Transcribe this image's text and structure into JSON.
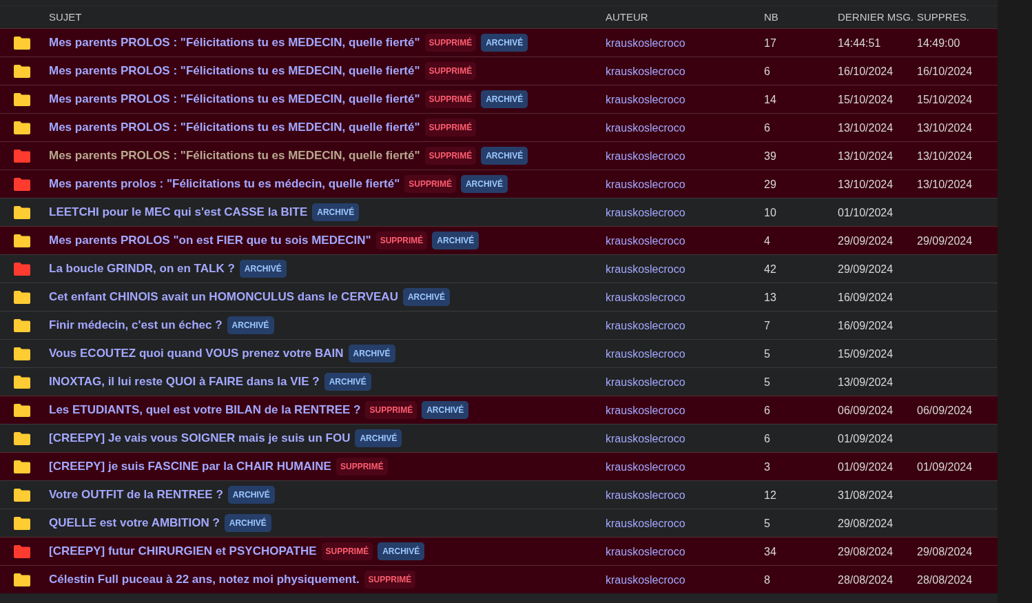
{
  "columns": [
    "SUJET",
    "AUTEUR",
    "NB",
    "DERNIER MSG.",
    "SUPPRES."
  ],
  "rows": [
    {
      "title": "Mes parents PROLOS : \"Félicitations tu es MEDECIN, quelle fierté\"",
      "color": "#ffcc33",
      "visited": false,
      "deleted_badge": "SUPPRIMÉ",
      "archived_badge": "ARCHIVÉ",
      "author": "krauskoslecroco",
      "count": "17",
      "last_message": "14:44:51",
      "deleted_at": "14:49:00"
    },
    {
      "title": "Mes parents PROLOS : \"Félicitations tu es MEDECIN, quelle fierté\"",
      "color": "#ffcc33",
      "visited": false,
      "deleted_badge": "SUPPRIMÉ",
      "author": "krauskoslecroco",
      "count": "6",
      "last_message": "16/10/2024",
      "deleted_at": "16/10/2024"
    },
    {
      "title": "Mes parents PROLOS : \"Félicitations tu es MEDECIN, quelle fierté\"",
      "color": "#ffcc33",
      "visited": false,
      "deleted_badge": "SUPPRIMÉ",
      "archived_badge": "ARCHIVÉ",
      "author": "krauskoslecroco",
      "count": "14",
      "last_message": "15/10/2024",
      "deleted_at": "15/10/2024"
    },
    {
      "title": "Mes parents PROLOS : \"Félicitations tu es MEDECIN, quelle fierté\"",
      "color": "#ffcc33",
      "visited": false,
      "deleted_badge": "SUPPRIMÉ",
      "author": "krauskoslecroco",
      "count": "6",
      "last_message": "13/10/2024",
      "deleted_at": "13/10/2024"
    },
    {
      "title": "Mes parents PROLOS : \"Félicitations tu es MEDECIN, quelle fierté\"",
      "color": "#ff3b2f",
      "visited": true,
      "deleted_badge": "SUPPRIMÉ",
      "archived_badge": "ARCHIVÉ",
      "author": "krauskoslecroco",
      "count": "39",
      "last_message": "13/10/2024",
      "deleted_at": "13/10/2024"
    },
    {
      "title": "Mes parents prolos : \"Félicitations tu es médecin, quelle fierté\"",
      "color": "#ff3b2f",
      "visited": false,
      "deleted_badge": "SUPPRIMÉ",
      "archived_badge": "ARCHIVÉ",
      "author": "krauskoslecroco",
      "count": "29",
      "last_message": "13/10/2024",
      "deleted_at": "13/10/2024"
    },
    {
      "title": "LEETCHI pour le MEC qui s'est CASSE la BITE",
      "color": "#ffcc33",
      "visited": false,
      "archived_badge": "ARCHIVÉ",
      "author": "krauskoslecroco",
      "count": "10",
      "last_message": "01/10/2024"
    },
    {
      "title": "Mes parents PROLOS \"on est FIER que tu sois MEDECIN\"",
      "color": "#ffcc33",
      "visited": false,
      "deleted_badge": "SUPPRIMÉ",
      "archived_badge": "ARCHIVÉ",
      "author": "krauskoslecroco",
      "count": "4",
      "last_message": "29/09/2024",
      "deleted_at": "29/09/2024"
    },
    {
      "title": "La boucle GRINDR, on en TALK ?",
      "color": "#ff3b2f",
      "visited": false,
      "archived_badge": "ARCHIVÉ",
      "author": "krauskoslecroco",
      "count": "42",
      "last_message": "29/09/2024"
    },
    {
      "title": "Cet enfant CHINOIS avait un HOMONCULUS dans le CERVEAU",
      "color": "#ffcc33",
      "visited": false,
      "archived_badge": "ARCHIVÉ",
      "author": "krauskoslecroco",
      "count": "13",
      "last_message": "16/09/2024"
    },
    {
      "title": "Finir médecin, c'est un échec ?",
      "color": "#ffcc33",
      "visited": false,
      "archived_badge": "ARCHIVÉ",
      "author": "krauskoslecroco",
      "count": "7",
      "last_message": "16/09/2024"
    },
    {
      "title": "Vous ECOUTEZ quoi quand VOUS prenez votre BAIN",
      "color": "#ffcc33",
      "visited": false,
      "archived_badge": "ARCHIVÉ",
      "author": "krauskoslecroco",
      "count": "5",
      "last_message": "15/09/2024"
    },
    {
      "title": "INOXTAG, il lui reste QUOI à FAIRE dans la VIE ?",
      "color": "#ffcc33",
      "visited": false,
      "archived_badge": "ARCHIVÉ",
      "author": "krauskoslecroco",
      "count": "5",
      "last_message": "13/09/2024"
    },
    {
      "title": "Les ETUDIANTS, quel est votre BILAN de la RENTREE ?",
      "color": "#ffcc33",
      "visited": false,
      "deleted_badge": "SUPPRIMÉ",
      "archived_badge": "ARCHIVÉ",
      "author": "krauskoslecroco",
      "count": "6",
      "last_message": "06/09/2024",
      "deleted_at": "06/09/2024"
    },
    {
      "title": "[CREEPY] Je vais vous SOIGNER mais je suis un FOU",
      "color": "#ffcc33",
      "visited": false,
      "archived_badge": "ARCHIVÉ",
      "author": "krauskoslecroco",
      "count": "6",
      "last_message": "01/09/2024"
    },
    {
      "title": "[CREEPY] je suis FASCINE par la CHAIR HUMAINE",
      "color": "#ffcc33",
      "visited": false,
      "deleted_badge": "SUPPRIMÉ",
      "author": "krauskoslecroco",
      "count": "3",
      "last_message": "01/09/2024",
      "deleted_at": "01/09/2024"
    },
    {
      "title": "Votre OUTFIT de la RENTREE ?",
      "color": "#ffcc33",
      "visited": false,
      "archived_badge": "ARCHIVÉ",
      "author": "krauskoslecroco",
      "count": "12",
      "last_message": "31/08/2024"
    },
    {
      "title": "QUELLE est votre AMBITION ?",
      "color": "#ffcc33",
      "visited": false,
      "archived_badge": "ARCHIVÉ",
      "author": "krauskoslecroco",
      "count": "5",
      "last_message": "29/08/2024"
    },
    {
      "title": "[CREEPY] futur CHIRURGIEN et PSYCHOPATHE",
      "color": "#ff3b2f",
      "visited": false,
      "deleted_badge": "SUPPRIMÉ",
      "archived_badge": "ARCHIVÉ",
      "author": "krauskoslecroco",
      "count": "34",
      "last_message": "29/08/2024",
      "deleted_at": "29/08/2024"
    },
    {
      "title": "Célestin Full puceau à 22 ans, notez moi physiquement.",
      "color": "#ffcc33",
      "visited": false,
      "deleted_badge": "SUPPRIMÉ",
      "author": "krauskoslecroco",
      "count": "8",
      "last_message": "28/08/2024",
      "deleted_at": "28/08/2024"
    }
  ]
}
